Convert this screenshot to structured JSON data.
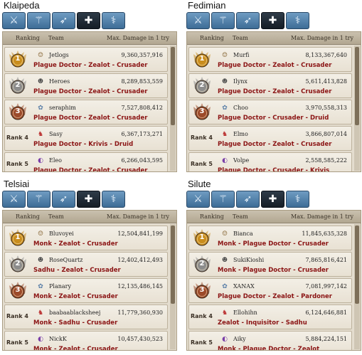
{
  "tab_icons": [
    "sword-icon",
    "staff-icon",
    "bow-icon",
    "cross-icon",
    "mage-icon"
  ],
  "header": {
    "ranking": "Ranking",
    "team": "Team",
    "damage": "Max. Damage in 1 try"
  },
  "colors": {
    "gold": "#c98d1d",
    "silver": "#8c8c8c",
    "bronze": "#9c4a2a",
    "class_text": "#8b1414"
  },
  "regions": [
    {
      "name": "Klaipeda",
      "entries": [
        {
          "rank": 1,
          "rank_label": "1",
          "team": "Jetlogs",
          "damage": "9,360,357,916",
          "classes": "Plague Doctor - Zealot - Crusader"
        },
        {
          "rank": 2,
          "rank_label": "2",
          "team": "Heroes",
          "damage": "8,289,853,559",
          "classes": "Plague Doctor - Zealot - Crusader"
        },
        {
          "rank": 3,
          "rank_label": "3",
          "team": "seraphim",
          "damage": "7,527,808,412",
          "classes": "Plague Doctor - Zealot - Crusader"
        },
        {
          "rank": 4,
          "rank_label": "Rank 4",
          "team": "Sasy",
          "damage": "6,367,173,271",
          "classes": "Plague Doctor - Krivis - Druid"
        },
        {
          "rank": 5,
          "rank_label": "Rank 5",
          "team": "Eleo",
          "damage": "6,266,043,595",
          "classes": "Plague Doctor - Zealot - Crusader"
        }
      ]
    },
    {
      "name": "Fedimian",
      "entries": [
        {
          "rank": 1,
          "rank_label": "1",
          "team": "Murfi",
          "damage": "8,133,367,640",
          "classes": "Plague Doctor - Zealot - Crusader"
        },
        {
          "rank": 2,
          "rank_label": "2",
          "team": "Ilynx",
          "damage": "5,611,413,828",
          "classes": "Plague Doctor - Zealot - Crusader"
        },
        {
          "rank": 3,
          "rank_label": "3",
          "team": "Choo",
          "damage": "3,970,558,313",
          "classes": "Plague Doctor - Crusader - Druid"
        },
        {
          "rank": 4,
          "rank_label": "Rank 4",
          "team": "Elmo",
          "damage": "3,866,807,014",
          "classes": "Plague Doctor - Zealot - Crusader"
        },
        {
          "rank": 5,
          "rank_label": "Rank 5",
          "team": "Volpe",
          "damage": "2,558,585,222",
          "classes": "Plague Doctor - Crusader - Krivis"
        }
      ]
    },
    {
      "name": "Telsiai",
      "entries": [
        {
          "rank": 1,
          "rank_label": "1",
          "team": "Bluvoyei",
          "damage": "12,504,841,199",
          "classes": "Monk - Zealot - Crusader"
        },
        {
          "rank": 2,
          "rank_label": "2",
          "team": "RoseQuartz",
          "damage": "12,402,412,493",
          "classes": "Sadhu - Zealot - Crusader"
        },
        {
          "rank": 3,
          "rank_label": "3",
          "team": "Planary",
          "damage": "12,135,486,145",
          "classes": "Monk - Zealot - Crusader"
        },
        {
          "rank": 4,
          "rank_label": "Rank 4",
          "team": "baabaablacksheej",
          "damage": "11,779,360,930",
          "classes": "Monk - Sadhu - Crusader"
        },
        {
          "rank": 5,
          "rank_label": "Rank 5",
          "team": "NickK",
          "damage": "10,457,430,523",
          "classes": "Monk - Zealot - Crusader"
        }
      ]
    },
    {
      "name": "Silute",
      "entries": [
        {
          "rank": 1,
          "rank_label": "1",
          "team": "Bianca",
          "damage": "11,845,635,328",
          "classes": "Monk - Plague Doctor - Crusader"
        },
        {
          "rank": 2,
          "rank_label": "2",
          "team": "SukiKioshi",
          "damage": "7,865,816,421",
          "classes": "Monk - Plague Doctor - Crusader"
        },
        {
          "rank": 3,
          "rank_label": "3",
          "team": "XANAX",
          "damage": "7,081,997,142",
          "classes": "Plague Doctor - Zealot - Pardoner"
        },
        {
          "rank": 4,
          "rank_label": "Rank 4",
          "team": "Ellohihn",
          "damage": "6,124,646,881",
          "classes": "Zealot - Inquisitor - Sadhu"
        },
        {
          "rank": 5,
          "rank_label": "Rank 5",
          "team": "Aiky",
          "damage": "5,884,224,151",
          "classes": "Monk - Plague Doctor - Zealot"
        }
      ]
    }
  ]
}
